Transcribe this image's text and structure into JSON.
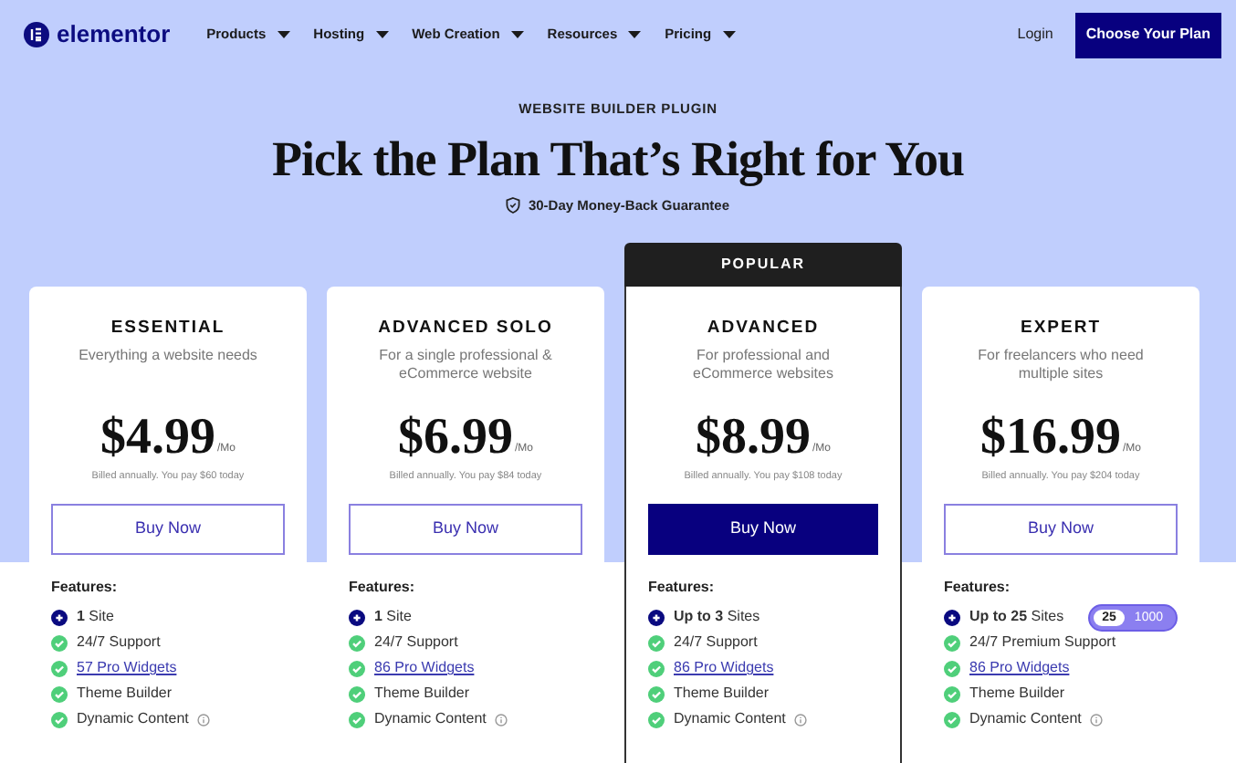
{
  "nav": {
    "logo": "elementor",
    "items": [
      {
        "label": "Products"
      },
      {
        "label": "Hosting"
      },
      {
        "label": "Web Creation"
      },
      {
        "label": "Resources"
      },
      {
        "label": "Pricing"
      }
    ],
    "login": "Login",
    "cta": "Choose Your Plan"
  },
  "hero": {
    "eyebrow": "WEBSITE BUILDER PLUGIN",
    "title": "Pick the Plan That’s Right for You",
    "guarantee": "30-Day Money-Back Guarantee"
  },
  "plans": [
    {
      "name": "ESSENTIAL",
      "popular": false,
      "description": "Everything a website needs",
      "price": "$4.99",
      "period": "/Mo",
      "billing": "Billed annually. You pay $60 today",
      "button": "Buy Now",
      "features_label": "Features:",
      "features": [
        {
          "kind": "sites",
          "text": "**1** Site"
        },
        {
          "kind": "check",
          "text": "24/7 Support"
        },
        {
          "kind": "link",
          "text": "57 Pro Widgets"
        },
        {
          "kind": "check",
          "text": "Theme Builder"
        },
        {
          "kind": "info",
          "text": "Dynamic Content"
        }
      ]
    },
    {
      "name": "ADVANCED SOLO",
      "popular": false,
      "description": "For a single professional & eCommerce website",
      "price": "$6.99",
      "period": "/Mo",
      "billing": "Billed annually. You pay $84 today",
      "button": "Buy Now",
      "features_label": "Features:",
      "features": [
        {
          "kind": "sites",
          "text": "**1** Site"
        },
        {
          "kind": "check",
          "text": "24/7 Support"
        },
        {
          "kind": "link",
          "text": "86 Pro Widgets"
        },
        {
          "kind": "check",
          "text": "Theme Builder"
        },
        {
          "kind": "info",
          "text": "Dynamic Content"
        }
      ]
    },
    {
      "name": "ADVANCED",
      "popular": true,
      "badge": "POPULAR",
      "description": "For professional and eCommerce websites",
      "price": "$8.99",
      "period": "/Mo",
      "billing": "Billed annually. You pay $108 today",
      "button": "Buy Now",
      "features_label": "Features:",
      "features": [
        {
          "kind": "sites",
          "text": "**Up to 3** Sites"
        },
        {
          "kind": "check",
          "text": "24/7 Support"
        },
        {
          "kind": "link",
          "text": "86 Pro Widgets"
        },
        {
          "kind": "check",
          "text": "Theme Builder"
        },
        {
          "kind": "info",
          "text": "Dynamic Content"
        }
      ]
    },
    {
      "name": "EXPERT",
      "popular": false,
      "description": "For freelancers who need multiple sites",
      "price": "$16.99",
      "period": "/Mo",
      "billing": "Billed annually. You pay $204 today",
      "button": "Buy Now",
      "features_label": "Features:",
      "site_options": [
        {
          "label": "25",
          "selected": true
        },
        {
          "label": "1000",
          "selected": false
        }
      ],
      "features": [
        {
          "kind": "sites",
          "text": "**Up to 25** Sites"
        },
        {
          "kind": "check",
          "text": "24/7 Premium Support"
        },
        {
          "kind": "link",
          "text": "86 Pro Widgets"
        },
        {
          "kind": "check",
          "text": "Theme Builder"
        },
        {
          "kind": "info",
          "text": "Dynamic Content"
        }
      ]
    }
  ]
}
